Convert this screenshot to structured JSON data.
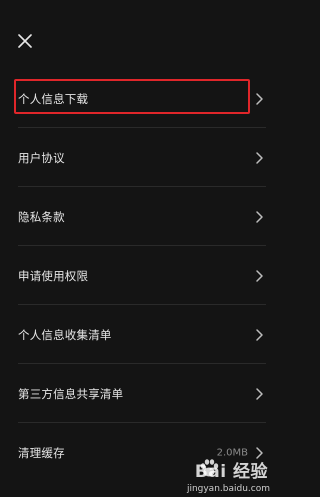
{
  "header": {
    "close_icon": "close-icon"
  },
  "menu": {
    "items": [
      {
        "label": "个人信息下载",
        "icon": "chevron-right-icon"
      },
      {
        "label": "用户协议",
        "icon": "chevron-right-icon"
      },
      {
        "label": "隐私条款",
        "icon": "chevron-right-icon"
      },
      {
        "label": "申请使用权限",
        "icon": "chevron-right-icon"
      },
      {
        "label": "个人信息收集清单",
        "icon": "chevron-right-icon"
      },
      {
        "label": "第三方信息共享清单",
        "icon": "chevron-right-icon"
      },
      {
        "label": "清理缓存",
        "value": "2.0MB",
        "icon": "chevron-right-icon"
      }
    ]
  },
  "annotation": {
    "highlight_color": "#e0262a"
  },
  "watermark": {
    "brand": "Bai 经验",
    "domain": "jingyan.baidu.com"
  },
  "colors": {
    "background": "#141414",
    "text": "#e6e6e6",
    "divider": "#2a2a2a"
  }
}
